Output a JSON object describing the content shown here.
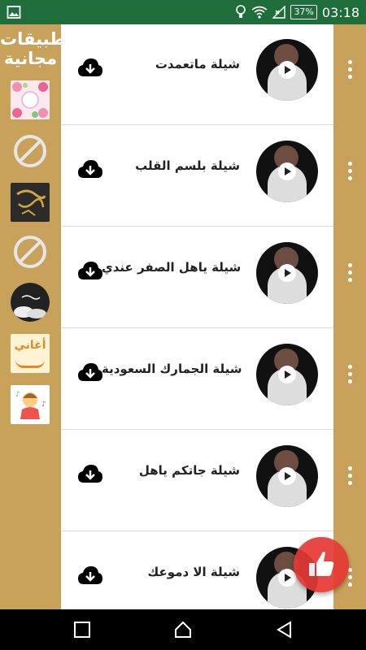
{
  "status_bar": {
    "battery": "37%",
    "time": "03:18"
  },
  "sidebar": {
    "title_line1": "تطبيقات",
    "title_line2": "مجانية",
    "apps": [
      {
        "name": "app-tile-flowers",
        "icon": "flowers-app-icon"
      },
      {
        "name": "app-tile-blocked-1",
        "icon": "ban-icon"
      },
      {
        "name": "app-tile-calligraphy",
        "icon": "calligraphy-app-icon"
      },
      {
        "name": "app-tile-blocked-2",
        "icon": "ban-icon"
      },
      {
        "name": "app-tile-clouds",
        "icon": "clouds-app-icon"
      },
      {
        "name": "app-tile-songs",
        "icon": "songs-app-icon",
        "text": "أغاني"
      },
      {
        "name": "app-tile-kids",
        "icon": "kids-app-icon"
      }
    ]
  },
  "list": {
    "items": [
      {
        "title": "شيلة ماتعمدت"
      },
      {
        "title": "شيلة بلسم القلب"
      },
      {
        "title": "شيلة ياهل الصفر عندي"
      },
      {
        "title": "شيلة الجمارك السعودية"
      },
      {
        "title": "شيلة جاتكم ياهل"
      },
      {
        "title": "شيلة الا دموعك"
      }
    ]
  },
  "colors": {
    "status_bar": "#1f6d3b",
    "gold": "#c8a25a",
    "fab": "#e53935"
  },
  "icons": {
    "download": "cloud-download-icon",
    "play": "play-icon",
    "menu": "more-vert-icon",
    "fab": "thumbs-up-icon"
  }
}
